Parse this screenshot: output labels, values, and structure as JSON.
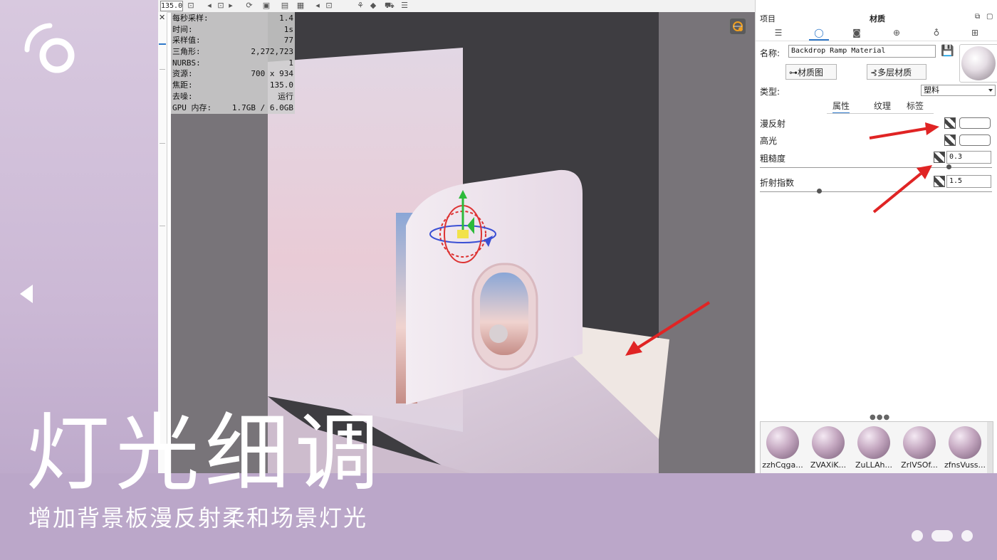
{
  "slide": {
    "title": "灯光细调",
    "subtitle": "增加背景板漫反射柔和场景灯光",
    "colors": {
      "accent": "#ffffff",
      "band": "#bba7c9",
      "arrow": "#e02424"
    }
  },
  "toolbar": {
    "zoom_value": "135.0"
  },
  "stats": [
    {
      "label": "每秒采样:",
      "value": "1.4"
    },
    {
      "label": "时间:",
      "value": "1s"
    },
    {
      "label": "采样值:",
      "value": "77"
    },
    {
      "label": "三角形:",
      "value": "2,272,723"
    },
    {
      "label": "NURBS:",
      "value": "1"
    },
    {
      "label": "资源:",
      "value": "700 x 934"
    },
    {
      "label": "焦距:",
      "value": "135.0"
    },
    {
      "label": "去噪:",
      "value": "运行"
    },
    {
      "label": "GPU 内存:",
      "value": "1.7GB / 6.0GB"
    }
  ],
  "panel": {
    "header_left": "项目",
    "header_center": "材质",
    "tabs": [
      "list-icon",
      "material-icon",
      "camera-icon",
      "globe-icon",
      "bulb-icon",
      "crop-icon"
    ],
    "name_label": "名称:",
    "name_value": "Backdrop Ramp Material",
    "btn_graph": "材质图",
    "btn_multilayer": "多层材质",
    "type_label": "类型:",
    "type_value": "塑料",
    "subtabs": [
      "属性",
      "纹理",
      "标签"
    ],
    "diffuse_label": "漫反射",
    "specular_label": "高光",
    "roughness_label": "粗糙度",
    "roughness_value": "0.3",
    "ior_label": "折射指数",
    "ior_value": "1.5",
    "gallery_dots": "●●●",
    "gallery": [
      "zzhCqga...",
      "ZVAXiK...",
      "ZuLLAh...",
      "ZrlVSOf...",
      "zfnsVuss..."
    ]
  }
}
